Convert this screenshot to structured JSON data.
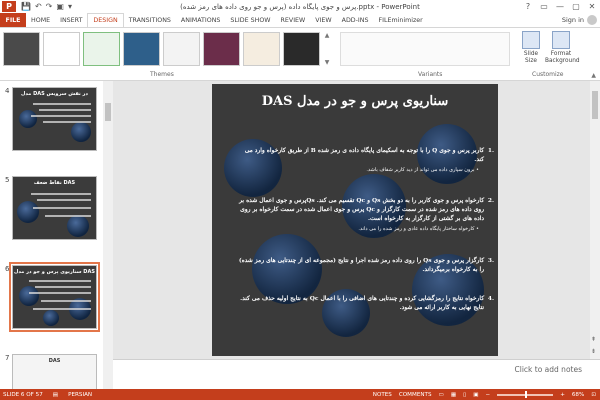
{
  "window": {
    "title": "پرس و جوی پایگاه داده (پرس و جو روی داده های رمز شده).pptx - PowerPoint",
    "app_icon": "P",
    "qat": [
      "💾",
      "↶",
      "↷",
      "▣",
      "▾"
    ],
    "controls": [
      "?",
      "▭",
      "—",
      "▢",
      "✕"
    ]
  },
  "ribbon": {
    "file_tab": "FILE",
    "tabs": [
      "HOME",
      "INSERT",
      "DESIGN",
      "TRANSITIONS",
      "ANIMATIONS",
      "SLIDE SHOW",
      "REVIEW",
      "VIEW",
      "ADD-INS",
      "FILEminimizer"
    ],
    "active_tab": "DESIGN",
    "sign_in": "Sign in",
    "group_themes": "Themes",
    "group_variants": "Variants",
    "group_customize": "Customize",
    "slide_size_label": "Slide Size",
    "format_bg_label": "Format Background",
    "collapse": "▲",
    "theme_colors": [
      "#4a4a4a",
      "#ffffff",
      "#7fbf7f",
      "#2e5f8a",
      "#f3f3f3",
      "#6b2d4a",
      "#f5ede0",
      "#2a2a2a"
    ]
  },
  "slide_panel": {
    "thumbnails": [
      {
        "number": "4",
        "title": "مدل DAS در نقش سرویس"
      },
      {
        "number": "5",
        "title": "نقاط ضعف DAS"
      },
      {
        "number": "6",
        "title": "سناریوی پرس و جو در مدل DAS"
      },
      {
        "number": "7",
        "title": "DAS"
      }
    ]
  },
  "slide": {
    "title": "سناریوی پرس و جو در مدل DAS",
    "items": [
      {
        "number": ".1",
        "text": "کاربر پرس و جوی Q را با توجه به اسکیمای پایگاه داده ی رمز شده B از طریق کارخواه وارد می کند.",
        "sub": "• برون سپاری داده می تواند از دید کاربر شفاف باشد."
      },
      {
        "number": ".2",
        "text": "کارخواه پرس و جوی کاربر را به دو بخش Qs و Qc تقسیم می کند. Qsپرس و جوی اعمال شده بر روی داده های رمز شده در سمت کارگزار و Qc پرس و جوی اعمال شده در سمت کارخواه بر روی داده های بر گشتی از کارگزار به کارخواه است.",
        "sub": "• کارخواه ساختار پایگاه داده عادی و رمز شده را می داند."
      },
      {
        "number": ".3",
        "text": "کارگزار پرس و جوی Qs را روی داده رمز شده اجرا و نتایج (مجموعه ای از چندتایی های رمز شده) را به کارخواه برمیگرداند.",
        "sub": ""
      },
      {
        "number": ".4",
        "text": "کارخواه نتایج را رمزگشایی کرده و چندتایی های اضافی را با اعمال Qc به نتایج اولیه حذف می کند. نتایج نهایی به کاربر ارائه می شود.",
        "sub": ""
      }
    ]
  },
  "notes": {
    "placeholder": "Click to add notes"
  },
  "status": {
    "slide_of": "SLIDE 6 OF 57",
    "language": "PERSIAN",
    "notes_btn": "NOTES",
    "comments_btn": "COMMENTS",
    "zoom": "68%"
  }
}
